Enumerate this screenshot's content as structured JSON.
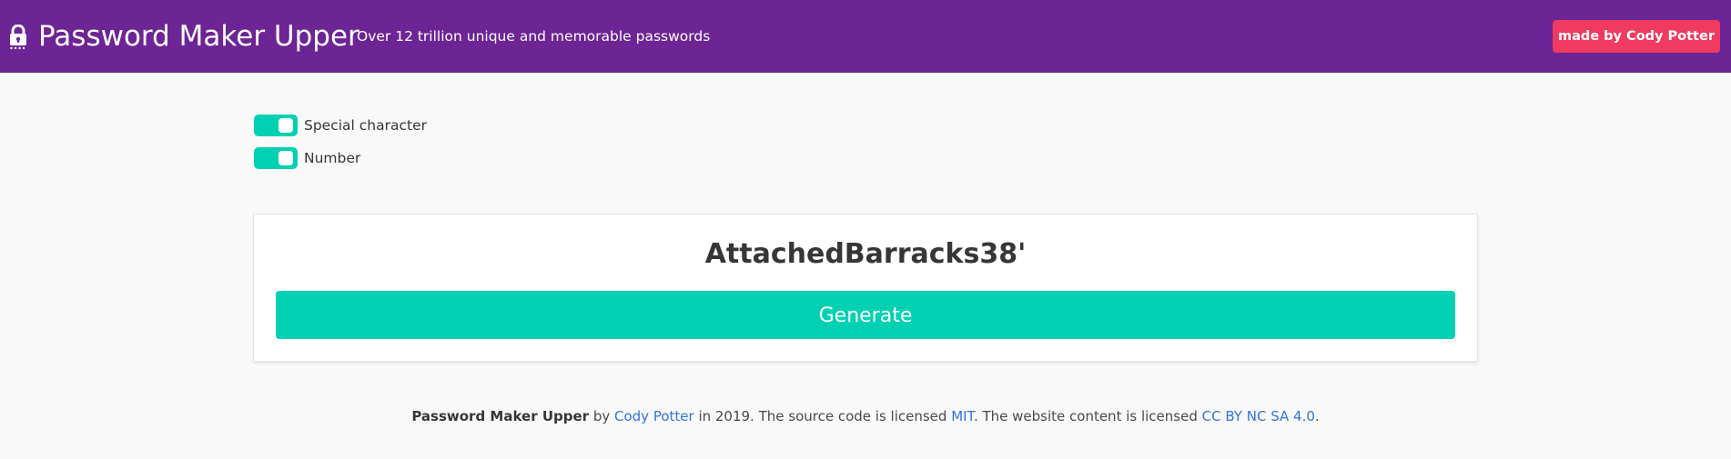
{
  "header": {
    "icon": "lock-icon",
    "title": "Password Maker Upper",
    "subtitle": "Over 12 trillion unique and memorable passwords",
    "made_by_label": "made by Cody Potter",
    "background_color": "#6d2494",
    "made_by_color": "#f03a5f"
  },
  "options": {
    "special_character": {
      "label": "Special character",
      "enabled": true
    },
    "number": {
      "label": "Number",
      "enabled": true
    },
    "toggle_color": "#00d1b2"
  },
  "generator": {
    "password": "AttachedBarracks38'",
    "button_label": "Generate",
    "button_color": "#00d1b2"
  },
  "footer": {
    "app_name": "Password Maker Upper",
    "by": " by ",
    "author_link": "Cody Potter",
    "text1": " in 2019. The source code is licensed ",
    "license_code_link": "MIT",
    "text2": ". The website content is licensed ",
    "license_content_link": "CC BY NC SA 4.0",
    "text3": ".",
    "link_color": "#3273dc"
  }
}
